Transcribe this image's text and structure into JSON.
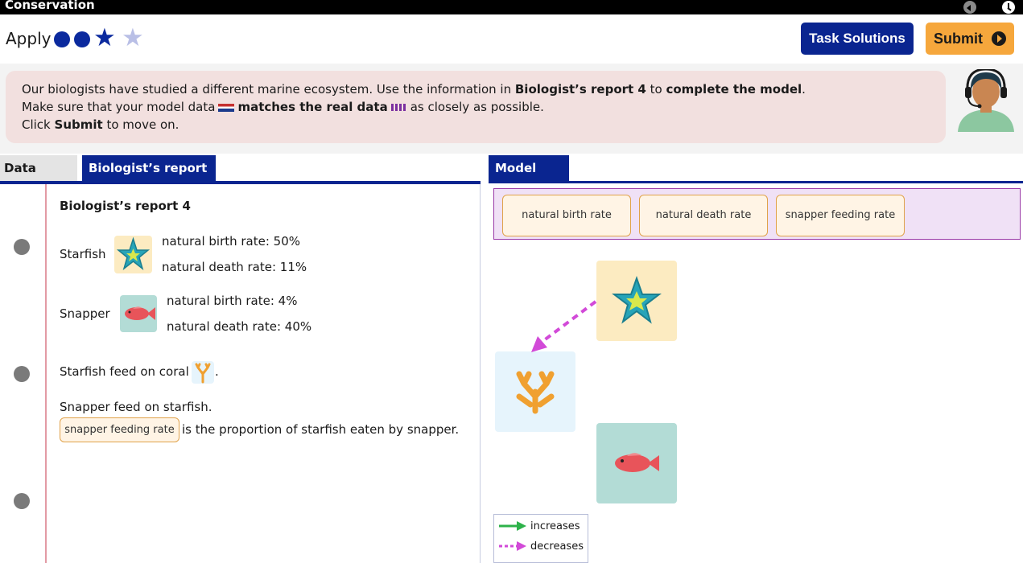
{
  "app": {
    "title": "Conservation"
  },
  "header": {
    "level_label": "Apply",
    "progress": {
      "completed": 3,
      "total": 4
    },
    "task_solutions_label": "Task Solutions",
    "submit_label": "Submit"
  },
  "instructions": {
    "line1_a": "Our biologists have studied a different marine ecosystem. Use the information in ",
    "line1_b": "Biologist’s report 4",
    "line1_c": " to ",
    "line1_d": "complete the model",
    "line1_e": ".",
    "line2_a": "Make sure that your model data",
    "line2_b": "matches the real data",
    "line2_c": "as closely as possible.",
    "line3_a": "Click ",
    "line3_b": "Submit",
    "line3_c": " to move on."
  },
  "tabs": {
    "data": "Data",
    "report": "Biologist’s report 4",
    "model": "Model"
  },
  "report": {
    "heading": "Biologist’s report 4",
    "starfish": {
      "name": "Starfish",
      "birth": "natural birth rate: 50%",
      "death": "natural death rate: 11%"
    },
    "snapper": {
      "name": "Snapper",
      "birth": "natural birth rate: 4%",
      "death": "natural death rate: 40%"
    },
    "coral_text": "Starfish feed on coral",
    "coral_suffix": ".",
    "snapper_feed": "Snapper feed on starfish.",
    "rate_chip": "snapper feeding rate",
    "rate_sentence": "is the proportion of starfish eaten by snapper."
  },
  "model": {
    "rate_chips": [
      "natural birth rate",
      "natural death rate",
      "snapper feeding rate"
    ],
    "legend": {
      "increases": "increases",
      "decreases": "decreases"
    }
  },
  "colors": {
    "navy": "#0a2590",
    "submit": "#f6a73c",
    "instruction_bg": "#f2e0df",
    "decrease_arrow": "#d24ad8",
    "increase_arrow": "#2db24a",
    "starfish_tile": "#fcebc1",
    "coral_tile": "#e6f4fc",
    "snapper_tile": "#b3dcd6"
  },
  "icons": [
    "back-icon",
    "clock-icon",
    "submit-arrow-icon",
    "starfish-icon",
    "snapper-icon",
    "coral-icon",
    "avatar-icon"
  ]
}
